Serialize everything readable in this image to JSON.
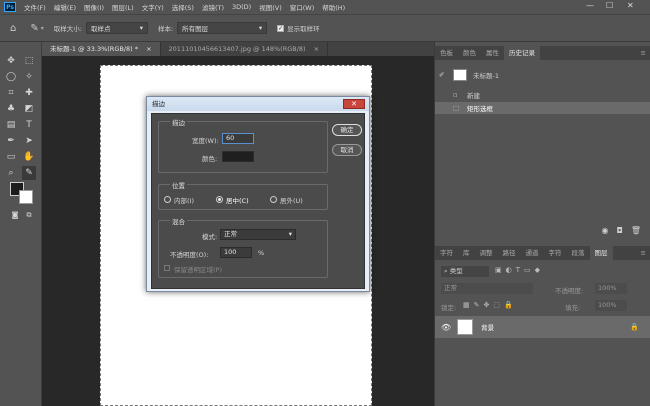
{
  "app": {
    "logo_text": "Ps"
  },
  "menu": [
    "文件(F)",
    "编辑(E)",
    "图像(I)",
    "图层(L)",
    "文字(Y)",
    "选择(S)",
    "滤镜(T)",
    "3D(D)",
    "视图(V)",
    "窗口(W)",
    "帮助(H)"
  ],
  "window_controls": {
    "minimize": "—",
    "maximize": "☐",
    "close": "✕"
  },
  "options": {
    "sample_size_label": "取样大小:",
    "sample_size_value": "取样点",
    "sample_label": "样本:",
    "sample_value": "所有图层",
    "show_ring_label": "显示取样环",
    "show_ring_checked": true
  },
  "doc_tabs": [
    {
      "label": "未标题-1 @ 33.3%(RGB/8) *",
      "close": "×"
    },
    {
      "label": "20111010456613407.jpg @ 148%(RGB/8)",
      "close": "×"
    }
  ],
  "right_top_tabs": [
    "色板",
    "颜色",
    "属性",
    "历史记录"
  ],
  "history": {
    "snapshot": "未标题-1",
    "items": [
      "新建",
      "矩形选框"
    ]
  },
  "layers_tabs": [
    "字符",
    "库",
    "调整",
    "路径",
    "通道",
    "字符",
    "段落",
    "图层"
  ],
  "layers": {
    "filter_label": "类型",
    "mode": "正常",
    "opacity_label": "不透明度:",
    "opacity_value": "100%",
    "lock_label": "锁定:",
    "fill_label": "填充:",
    "fill_value": "100%",
    "layer_name": "背景"
  },
  "dialog": {
    "title": "描边",
    "close": "✕",
    "stroke_group": "描边",
    "width_label": "宽度(W):",
    "width_value": "60",
    "color_label": "颜色:",
    "position_group": "位置",
    "inside": "内部(I)",
    "center": "居中(C)",
    "outside": "居外(U)",
    "blend_group": "混合",
    "mode_label": "模式:",
    "mode_value": "正常",
    "opacity_label": "不透明度(O):",
    "opacity_value": "100",
    "percent": "%",
    "preserve": "保留透明区域(P)",
    "ok": "确定",
    "cancel": "取消"
  }
}
